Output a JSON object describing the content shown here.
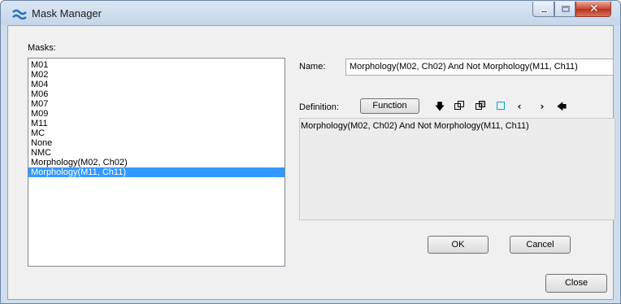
{
  "window": {
    "title": "Mask Manager",
    "icon": "wave-icon"
  },
  "masks": {
    "label": "Masks:",
    "items": [
      {
        "label": "M01",
        "selected": false
      },
      {
        "label": "M02",
        "selected": false
      },
      {
        "label": "M04",
        "selected": false
      },
      {
        "label": "M06",
        "selected": false
      },
      {
        "label": "M07",
        "selected": false
      },
      {
        "label": "M09",
        "selected": false
      },
      {
        "label": "M11",
        "selected": false
      },
      {
        "label": "MC",
        "selected": false
      },
      {
        "label": "None",
        "selected": false
      },
      {
        "label": "NMC",
        "selected": false
      },
      {
        "label": "Morphology(M02, Ch02)",
        "selected": false
      },
      {
        "label": "Morphology(M11, Ch11)",
        "selected": true
      }
    ]
  },
  "name": {
    "label": "Name:",
    "value": "Morphology(M02, Ch02) And Not Morphology(M11, Ch11)"
  },
  "definition": {
    "label": "Definition:",
    "function_button": "Function",
    "text": "Morphology(M02, Ch02) And Not Morphology(M11, Ch11)",
    "tools": [
      "down-arrow-icon",
      "union-icon",
      "intersection-icon",
      "empty-square-icon",
      "open-paren-icon",
      "close-paren-icon",
      "left-arrow-icon"
    ]
  },
  "buttons": {
    "ok": "OK",
    "cancel": "Cancel",
    "close": "Close"
  },
  "colors": {
    "selection": "#3399ff",
    "accent_square": "#00a8d8",
    "close_button": "#c84631"
  }
}
